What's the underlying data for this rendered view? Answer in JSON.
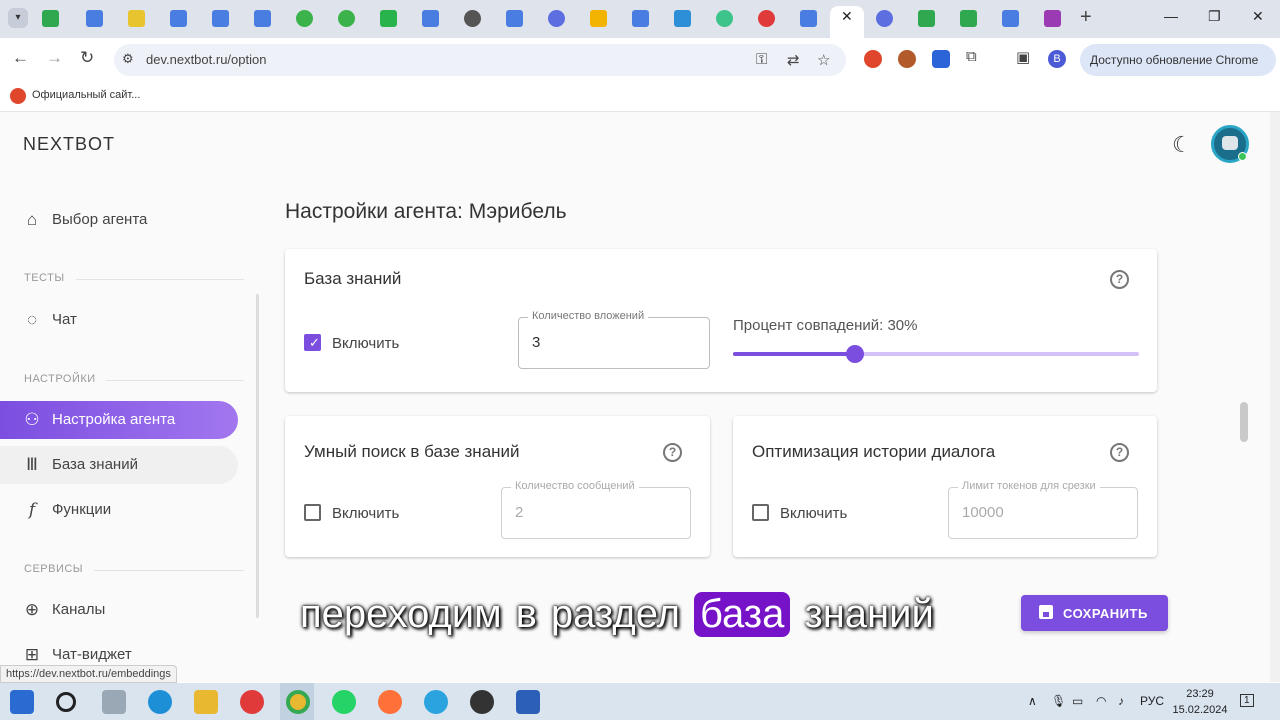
{
  "browser": {
    "url": "dev.nextbot.ru/option",
    "close_glyph": "✕",
    "new_tab_glyph": "+",
    "update_label": "Доступно обновление Chrome",
    "profile_initial": "B",
    "bookmark_label": "Официальный сайт...",
    "status_url": "https://dev.nextbot.ru/embeddings"
  },
  "app": {
    "logo": "NEXTBOT",
    "page_title": "Настройки агента: Мэрибель",
    "accent_color": "#7b4ee0"
  },
  "sidebar": {
    "items": [
      {
        "label": "Выбор агента",
        "icon": "robot-icon"
      },
      {
        "label": "Чат",
        "icon": "chat-icon"
      },
      {
        "label": "Настройка агента",
        "icon": "user-settings-icon"
      },
      {
        "label": "База знаний",
        "icon": "books-icon"
      },
      {
        "label": "Функции",
        "icon": "function-icon"
      },
      {
        "label": "Каналы",
        "icon": "globe-icon"
      },
      {
        "label": "Чат-виджет",
        "icon": "add-widget-icon"
      }
    ],
    "sections": {
      "tests": "ТЕСТЫ",
      "settings": "НАСТРОЙКИ",
      "services": "СЕРВИСЫ"
    }
  },
  "knowledge_base": {
    "title": "База знаний",
    "enable_label": "Включить",
    "enabled": true,
    "attachments_label": "Количество вложений",
    "attachments_value": "3",
    "match_label": "Процент совпадений: 30%",
    "match_percent": 30
  },
  "smart_search": {
    "title": "Умный поиск в базе знаний",
    "enable_label": "Включить",
    "enabled": false,
    "messages_label": "Количество сообщений",
    "messages_value": "2"
  },
  "history_optimization": {
    "title": "Оптимизация истории диалога",
    "enable_label": "Включить",
    "enabled": false,
    "token_label": "Лимит токенов для срезки",
    "token_value": "10000"
  },
  "save_button": {
    "label": "СОХРАНИТЬ"
  },
  "subtitle": {
    "word1": "переходим",
    "word2": "в",
    "word3": "раздел",
    "word4": "база",
    "word5": "знаний"
  },
  "taskbar": {
    "language": "РУС",
    "time": "23:29",
    "date": "15.02.2024",
    "notifications": "1"
  }
}
